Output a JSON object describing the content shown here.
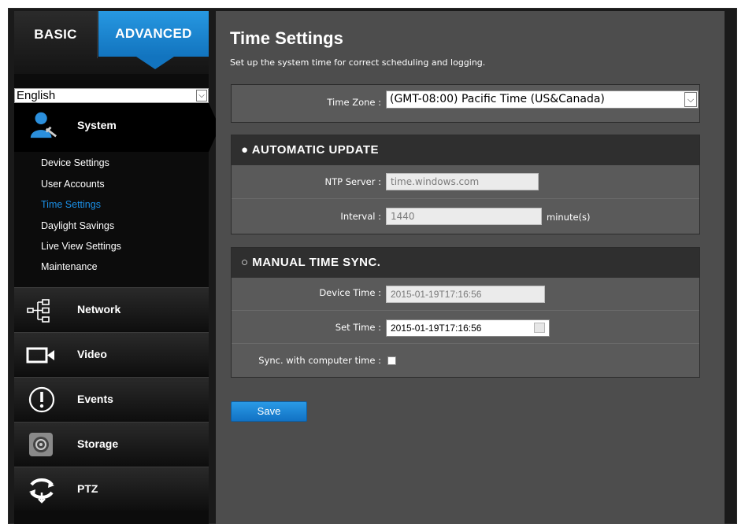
{
  "tabs": {
    "basic": "BASIC",
    "advanced": "ADVANCED"
  },
  "language": {
    "selected": "English"
  },
  "sidebar": {
    "system_title": "System",
    "system_items": [
      {
        "label": "Device Settings"
      },
      {
        "label": "User Accounts"
      },
      {
        "label": "Time Settings",
        "active": true
      },
      {
        "label": "Daylight Savings"
      },
      {
        "label": "Live View Settings"
      },
      {
        "label": "Maintenance"
      }
    ],
    "sections": [
      {
        "label": "Network",
        "icon": "network-icon"
      },
      {
        "label": "Video",
        "icon": "video-camera-icon"
      },
      {
        "label": "Events",
        "icon": "alert-icon"
      },
      {
        "label": "Storage",
        "icon": "storage-icon"
      },
      {
        "label": "PTZ",
        "icon": "ptz-icon"
      }
    ]
  },
  "page": {
    "title": "Time Settings",
    "subtitle": "Set up the system time for correct scheduling and logging."
  },
  "time_zone": {
    "label": "Time Zone :",
    "value": "(GMT-08:00) Pacific Time (US&Canada)"
  },
  "automatic": {
    "heading": "AUTOMATIC UPDATE",
    "ntp_label": "NTP Server :",
    "ntp_value": "time.windows.com",
    "interval_label": "Interval :",
    "interval_value": "1440",
    "interval_unit": "minute(s)"
  },
  "manual": {
    "heading": "MANUAL TIME SYNC.",
    "device_time_label": "Device Time :",
    "device_time_value": "2015-01-19T17:16:56",
    "set_time_label": "Set Time :",
    "set_time_value": "2015-01-19T17:16:56",
    "sync_label": "Sync. with computer time :"
  },
  "actions": {
    "save": "Save"
  },
  "colors": {
    "accent": "#1b8fe6",
    "panel": "#4d4d4d",
    "sidebar": "#0c0c0c"
  }
}
